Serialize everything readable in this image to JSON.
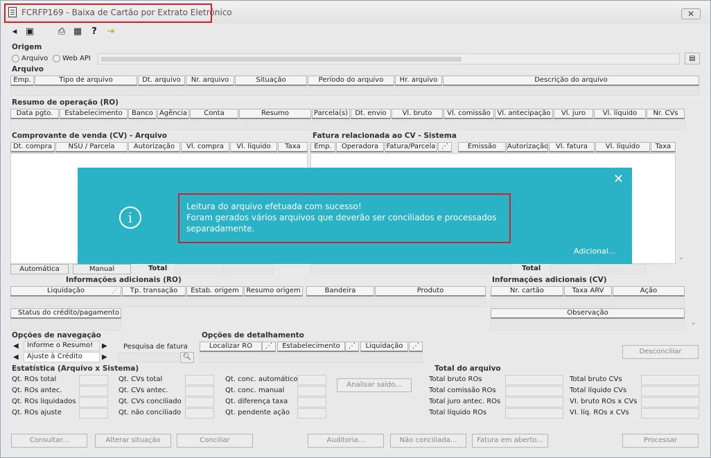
{
  "window": {
    "title": "FCRFP169 - Baixa de Cartão por Extrato Eletrônico",
    "close_label": "✕"
  },
  "toolbar": {
    "icons": [
      "back-icon",
      "forward-icon",
      "print-icon",
      "grid-icon",
      "help-icon",
      "exit-icon"
    ]
  },
  "origem": {
    "section": "Origem",
    "radio_arquivo": "Arquivo",
    "radio_webapi": "Web API"
  },
  "arquivo": {
    "section": "Arquivo",
    "columns": [
      "Emp.",
      "Tipo de arquivo",
      "Dt. arquivo",
      "Nr. arquivo",
      "Situação",
      "Período do arquivo",
      "Hr. arquivo",
      "Descrição do arquivo"
    ]
  },
  "resumo": {
    "section": "Resumo de operação (RO)",
    "columns": [
      "Data pgto.",
      "Estabelecimento",
      "Banco",
      "Agência",
      "Conta",
      "Resumo",
      "Parcela(s)",
      "Dt. envio",
      "Vl. bruto",
      "Vl. comissão",
      "Vl. antecipação",
      "Vl. juro",
      "Vl. líquido",
      "Nr. CVs"
    ]
  },
  "cv": {
    "section": "Comprovante de venda (CV) - Arquivo",
    "columns": [
      "Dt. compra",
      "NSU / Parcela",
      "Autorização",
      "Vl. compra",
      "Vl. líquido",
      "Taxa"
    ],
    "btn_automatica": "Automática",
    "btn_manual": "Manual",
    "total_label": "Total"
  },
  "fatura": {
    "section": "Fatura relacionada ao CV - Sistema",
    "columns": [
      "Emp.",
      "Operadora",
      "Fatura/Parcela",
      "Emissão",
      "Autorização",
      "Vl. fatura",
      "Vl. líquido",
      "Taxa"
    ],
    "total_label": "Total"
  },
  "info_ro": {
    "section": "Informações adicionais (RO)",
    "columns": [
      "Liquidação",
      "Tp. transação",
      "Estab. origem",
      "Resumo origem",
      "Bandeira",
      "Produto"
    ],
    "status_label": "Status do crédito/pagamento"
  },
  "info_cv": {
    "section": "Informações adicionais (CV)",
    "columns": [
      "Nr. cartão",
      "Taxa ARV",
      "Ação"
    ],
    "obs_label": "Observação"
  },
  "navegacao": {
    "section": "Opções de navegação",
    "item1": "Informe o Resumo!",
    "item2": "Ajuste à Crédito",
    "pesquisa_label": "Pesquisa de fatura"
  },
  "detalhamento": {
    "section": "Opções de detalhamento",
    "columns": [
      "Localizar RO",
      "Estabelecimento",
      "Liquidação"
    ]
  },
  "desconciliar_label": "Desconciliar",
  "estatistica": {
    "section": "Estatística (Arquivo x Sistema)",
    "col1": [
      "Qt. ROs total",
      "Qt. ROs antec.",
      "Qt. ROs liquidados",
      "Qt. ROs ajuste"
    ],
    "col2": [
      "Qt. CVs total",
      "Qt. CVs antec.",
      "Qt. CVs conciliado",
      "Qt. não conciliado"
    ],
    "col3": [
      "Qt. conc. automático",
      "Qt. conc. manual",
      "Qt. diferença taxa",
      "Qt. pendente ação"
    ],
    "analisar_label": "Analisar saldo..."
  },
  "total_arquivo": {
    "section": "Total do arquivo",
    "col1": [
      "Total bruto ROs",
      "Total comissão ROs",
      "Total juro antec. ROs",
      "Total líquido ROs"
    ],
    "col2": [
      "Total bruto CVs",
      "Total líquido CVs",
      "VI. bruto ROs x CVs",
      "VI. líq. ROs x CVs"
    ]
  },
  "footer": [
    "Consultar...",
    "Alterar situação",
    "Conciliar",
    "Auditoria...",
    "Não conciliada...",
    "Fatura em aberto...",
    "Processar"
  ],
  "dialog": {
    "line1": "Leitura do arquivo efetuada com sucesso!",
    "line2": "Foram gerados vários arquivos que deverão ser conciliados e processados",
    "line3": "separadamente.",
    "more": "Adicional...",
    "close": "✕",
    "info_icon": "i"
  },
  "colors": {
    "dialog_bg": "#2ab2c7",
    "highlight": "#d51f2a",
    "window_bg": "#e9e9e9"
  }
}
